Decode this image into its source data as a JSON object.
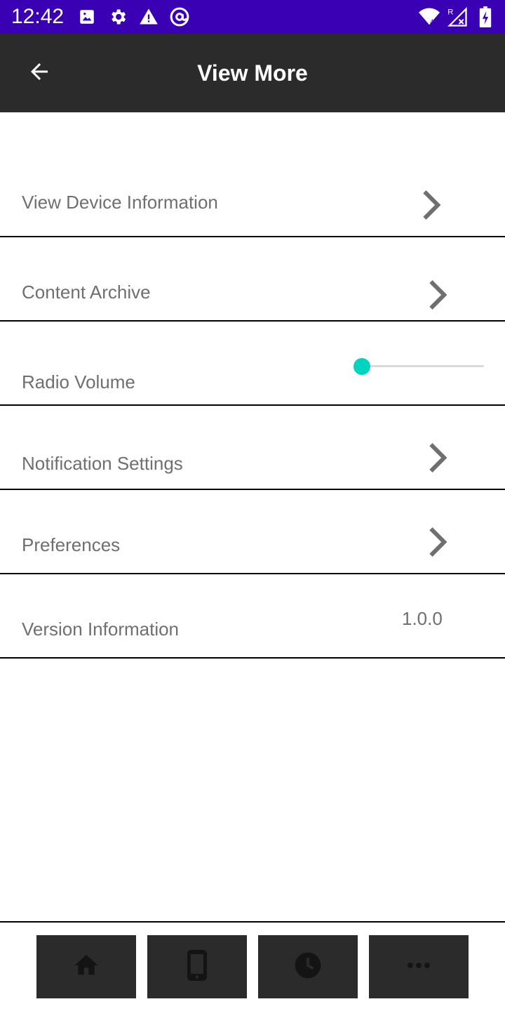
{
  "status_bar": {
    "time": "12:42",
    "bg_color": "#3a00b4",
    "left_icons": [
      "image-icon",
      "settings-gear-icon",
      "warning-icon",
      "at-sign-icon"
    ],
    "right_icons": [
      "wifi-icon",
      "signal-roaming-icon",
      "battery-charging-icon"
    ]
  },
  "app_bar": {
    "title": "View More",
    "back_icon": "arrow-left-icon",
    "bg_color": "#2b2b2b"
  },
  "settings": {
    "items": [
      {
        "label": "View Device Information",
        "type": "link",
        "icon": "chevron-right-icon"
      },
      {
        "label": "Content Archive",
        "type": "link",
        "icon": "chevron-right-icon"
      },
      {
        "label": "Radio Volume",
        "type": "slider"
      },
      {
        "label": "Notification Settings",
        "type": "link",
        "icon": "chevron-right-icon"
      },
      {
        "label": "Preferences",
        "type": "link",
        "icon": "chevron-right-icon"
      },
      {
        "label": "Version Information",
        "type": "value",
        "value": "1.0.0"
      }
    ],
    "radio_volume": {
      "value": 0,
      "min": 0,
      "max": 100,
      "accent_color": "#00d4c0"
    }
  },
  "bottom_nav": {
    "items": [
      {
        "name": "home",
        "icon": "home-icon"
      },
      {
        "name": "device",
        "icon": "phone-icon"
      },
      {
        "name": "history",
        "icon": "clock-icon"
      },
      {
        "name": "more",
        "icon": "more-horizontal-icon"
      }
    ]
  }
}
